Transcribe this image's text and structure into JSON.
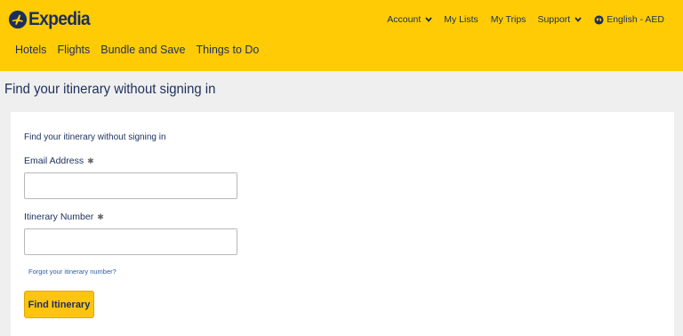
{
  "colors": {
    "header_bg": "#ffcb05",
    "brand_text": "#1b2f5e",
    "button_bg": "#fdc50d",
    "page_bg": "#efefef",
    "link": "#2b5ca8"
  },
  "header": {
    "logo_text": "Expedia",
    "logo_icon": "plane-circle-icon",
    "main_nav": [
      "Hotels",
      "Flights",
      "Bundle and Save",
      "Things to Do"
    ],
    "util_nav": {
      "account": "Account",
      "my_lists": "My Lists",
      "my_trips": "My Trips",
      "support": "Support",
      "language": "English - AED"
    }
  },
  "page": {
    "title": "Find your itinerary without signing in"
  },
  "form": {
    "subtitle": "Find your itinerary without signing in",
    "email_label": "Email Address",
    "itinerary_label": "Itinerary Number",
    "required_mark": "✱",
    "email_value": "",
    "itinerary_value": "",
    "forgot_link": "Forgot your itinerary number?",
    "submit_label": "Find Itinerary"
  }
}
